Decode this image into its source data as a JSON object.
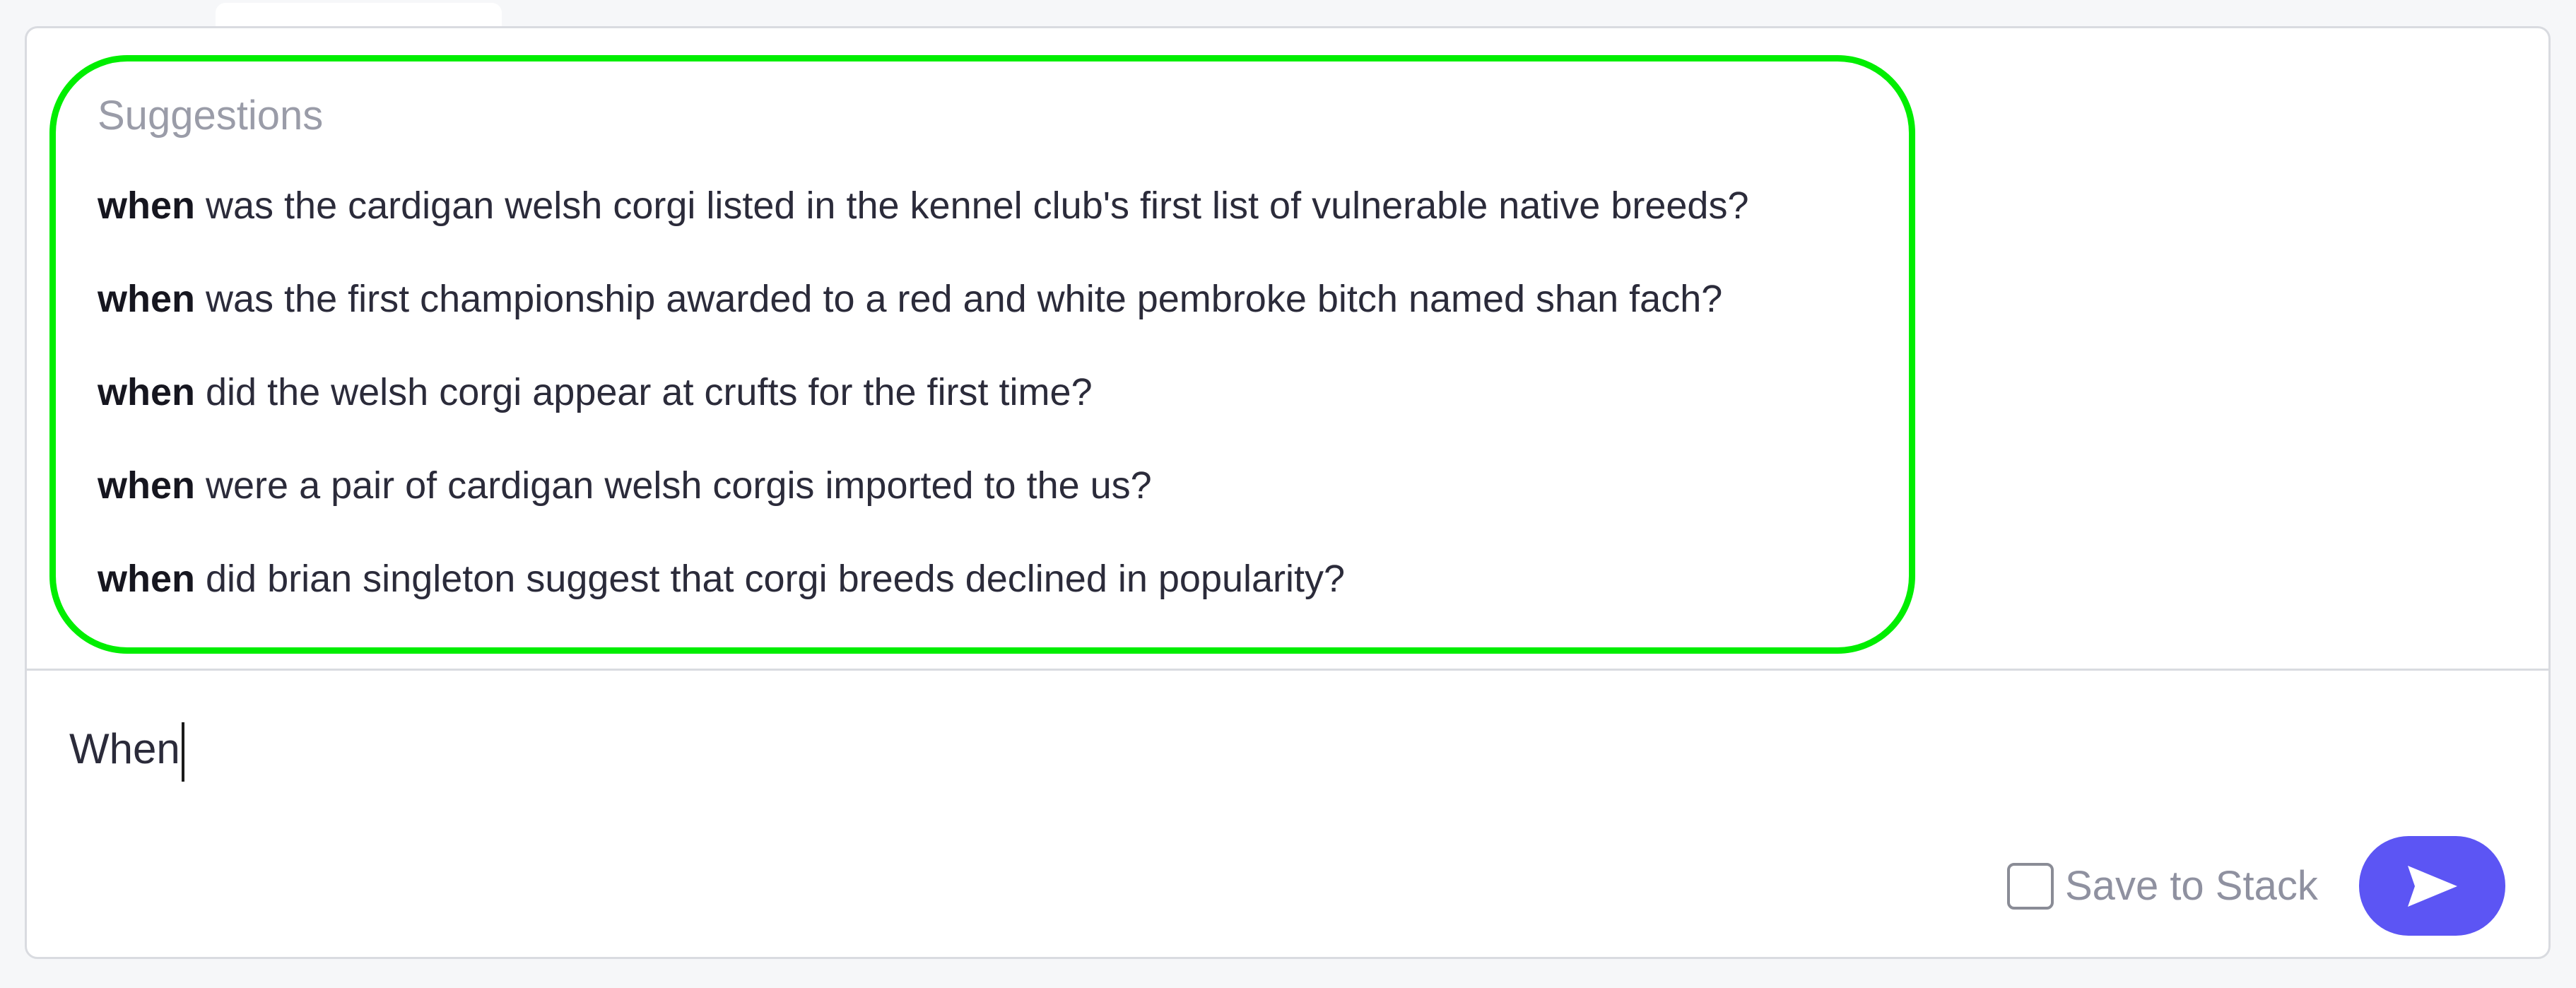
{
  "suggestions": {
    "title": "Suggestions",
    "items": [
      {
        "keyword": "when",
        "rest": " was the cardigan welsh corgi listed in the kennel club's first list of vulnerable native breeds?"
      },
      {
        "keyword": "when",
        "rest": " was the first championship awarded to a red and white pembroke bitch named shan fach?"
      },
      {
        "keyword": "when",
        "rest": " did the welsh corgi appear at crufts for the first time?"
      },
      {
        "keyword": "when",
        "rest": " were a pair of cardigan welsh corgis imported to the us?"
      },
      {
        "keyword": "when",
        "rest": " did brian singleton suggest that corgi breeds declined in popularity?"
      }
    ]
  },
  "input": {
    "value": "When"
  },
  "footer": {
    "save_label": "Save to Stack",
    "save_checked": false
  },
  "send": {
    "icon": "send-icon"
  },
  "colors": {
    "accent": "#5c55f4",
    "highlight": "#00ee00",
    "muted_text": "#9a9ca8"
  }
}
